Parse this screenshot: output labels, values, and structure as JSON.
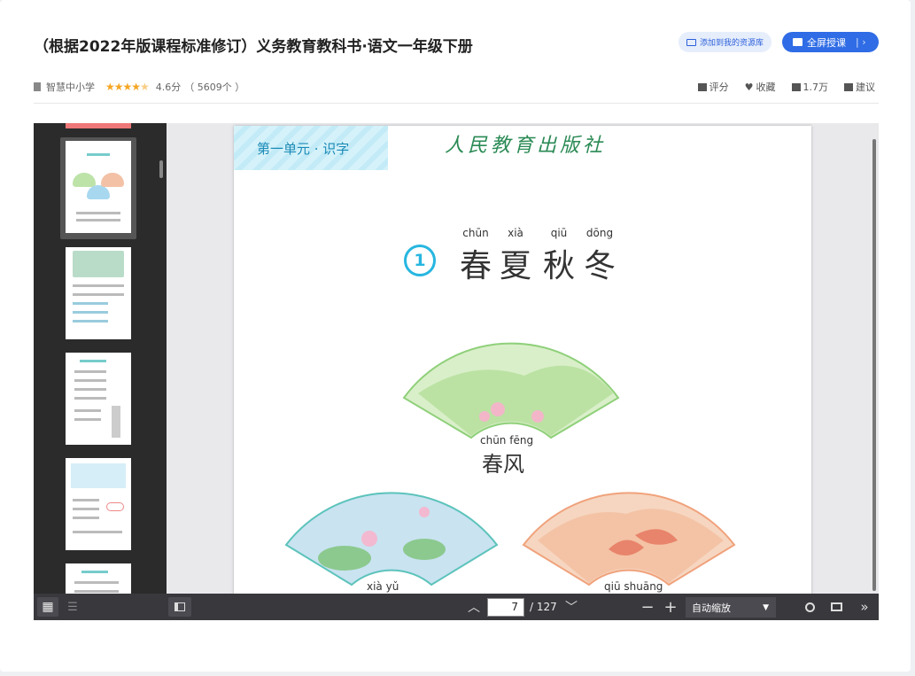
{
  "header": {
    "title": "（根据2022年版课程标准修订）义务教育教科书·语文一年级下册",
    "add_library_label": "添加到我的资源库",
    "fullscreen_label": "全屏授课"
  },
  "meta": {
    "source": "智慧中小学",
    "rating_stars": 4.6,
    "rating_text": "4.6分",
    "rating_count": "（ 5609个 ）"
  },
  "actions": {
    "rate": "评分",
    "favorite": "收藏",
    "likes": "1.7万",
    "suggest": "建议"
  },
  "page": {
    "unit": "第一单元 · 识字",
    "publisher": "人民教育出版社",
    "lesson_number": "1",
    "lesson_title_pinyin": [
      "chūn",
      "xià",
      "qiū",
      "dōng"
    ],
    "lesson_title_chars": [
      "春",
      "夏",
      "秋",
      "冬"
    ],
    "fans": [
      {
        "pinyin": "chūn fēng",
        "label": "春风"
      },
      {
        "pinyin": "xià yǔ",
        "label": ""
      },
      {
        "pinyin": "qiū shuāng",
        "label": ""
      }
    ]
  },
  "toolbar": {
    "current_page": "7",
    "page_total": "/ 127",
    "zoom_option": "自动缩放"
  },
  "colors": {
    "accent": "#2f6ce5",
    "star": "#f5a623",
    "unit_text": "#1b8ab6",
    "publisher": "#2a8a54"
  }
}
